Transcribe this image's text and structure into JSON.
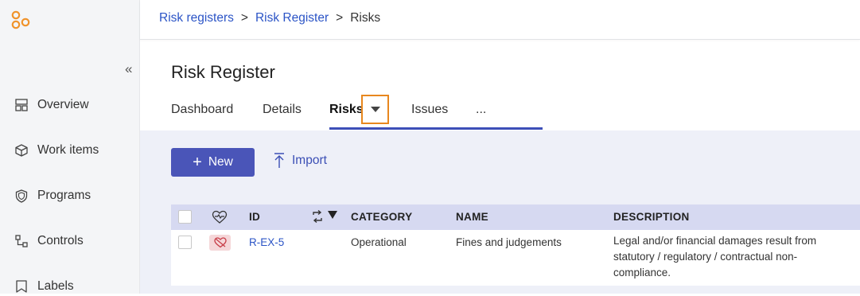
{
  "sidebar": {
    "collapse_label": "«",
    "items": [
      {
        "label": "Overview",
        "icon": "overview-icon"
      },
      {
        "label": "Work items",
        "icon": "cube-icon"
      },
      {
        "label": "Programs",
        "icon": "shield-icon"
      },
      {
        "label": "Controls",
        "icon": "controls-icon"
      },
      {
        "label": "Labels",
        "icon": "label-icon"
      }
    ]
  },
  "breadcrumb": {
    "items": [
      "Risk registers",
      "Risk Register"
    ],
    "separator": ">",
    "current": "Risks"
  },
  "page": {
    "title": "Risk Register"
  },
  "tabs": {
    "items": [
      "Dashboard",
      "Details",
      "Risks",
      "Issues"
    ],
    "more": "...",
    "active": "Risks"
  },
  "toolbar": {
    "new_label": "New",
    "import_label": "Import"
  },
  "table": {
    "columns": {
      "id": "ID",
      "category": "CATEGORY",
      "name": "NAME",
      "description": "DESCRIPTION"
    },
    "rows": [
      {
        "id": "R-EX-5",
        "category": "Operational",
        "name": "Fines and judgements",
        "description": "Legal and/or financial damages result from statutory / regulatory / contractual non-compliance."
      }
    ]
  },
  "colors": {
    "accent": "#4a55b8",
    "link": "#2b54c6",
    "highlight_border": "#e8871e",
    "header_bg": "#d6d9f1",
    "content_bg": "#eef0f8",
    "logo": "#f0932b"
  }
}
